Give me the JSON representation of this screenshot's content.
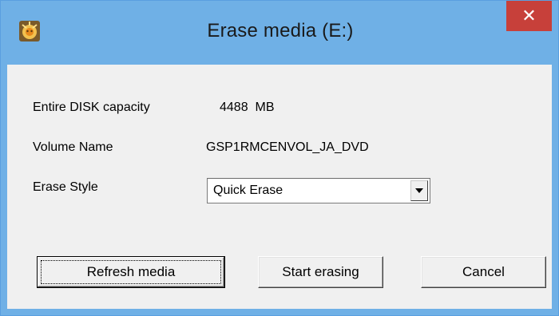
{
  "window": {
    "title": "Erase media (E:)",
    "close_symbol": "✕",
    "icon": "app-icon"
  },
  "fields": {
    "capacity_label": "Entire DISK capacity",
    "capacity_value": "4488  MB",
    "volume_label": "Volume Name",
    "volume_value": "GSP1RMCENVOL_JA_DVD",
    "erase_style_label": "Erase Style",
    "erase_style_selected": "Quick Erase"
  },
  "buttons": {
    "refresh": "Refresh media",
    "start": "Start erasing",
    "cancel": "Cancel"
  },
  "colors": {
    "titlebar": "#6fb0e6",
    "close_button": "#c7403a",
    "dialog_background": "#f0f0f0"
  }
}
